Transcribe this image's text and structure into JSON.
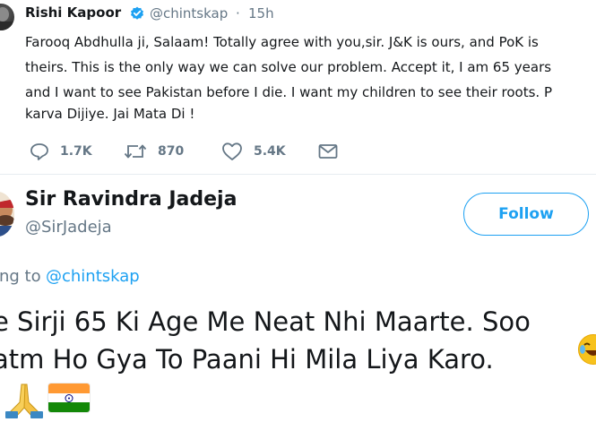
{
  "tweet1": {
    "author_name": "Rishi Kapoor",
    "handle": "@chintskap",
    "separator": "·",
    "time": "15h",
    "body_lines": [
      "Farooq Abdhulla ji, Salaam! Totally agree with you,sir. J&K is ours, and PoK is",
      "theirs. This is the only way we can solve our problem.  Accept it, I am 65 years",
      "and I want to see Pakistan before I die. I want my children to see their roots. P",
      "karva Dijiye. Jai Mata Di !"
    ],
    "actions": {
      "reply_icon": "reply-icon",
      "reply_count": "1.7K",
      "retweet_icon": "retweet-icon",
      "retweet_count": "870",
      "like_icon": "heart-icon",
      "like_count": "5.4K",
      "dm_icon": "envelope-icon"
    },
    "verified_icon": "verified-badge-icon"
  },
  "tweet2": {
    "author_name": "Sir Ravindra Jadeja",
    "handle": "@SirJadeja",
    "follow_label": "Follow",
    "reply_prefix": "ing to",
    "reply_handle": "@chintskap",
    "body_lines": [
      "e Sirji 65 Ki Age Me Neat Nhi Maarte. Soo",
      "atm Ho Gya To Paani Hi Mila Liya Karo."
    ],
    "emojis": [
      "face-with-tears-of-joy",
      "folded-hands",
      "flag-india"
    ]
  },
  "colors": {
    "brand_blue": "#1da1f2",
    "text": "#14171a",
    "muted": "#657786",
    "divider": "#e6ecf0"
  }
}
